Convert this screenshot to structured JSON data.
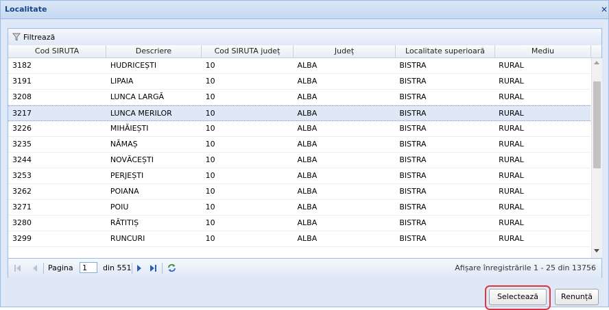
{
  "window": {
    "title": "Localitate",
    "close_label": "✕"
  },
  "toolbar": {
    "filter_label": "Filtrează"
  },
  "columns": [
    "Cod SIRUTA",
    "Descriere",
    "Cod SIRUTA județ",
    "Județ",
    "Localitate superioară",
    "Mediu"
  ],
  "rows": [
    [
      "3182",
      "HUDRICEȘTI",
      "10",
      "ALBA",
      "BISTRA",
      "RURAL"
    ],
    [
      "3191",
      "LIPAIA",
      "10",
      "ALBA",
      "BISTRA",
      "RURAL"
    ],
    [
      "3208",
      "LUNCA LARGĂ",
      "10",
      "ALBA",
      "BISTRA",
      "RURAL"
    ],
    [
      "3217",
      "LUNCA MERILOR",
      "10",
      "ALBA",
      "BISTRA",
      "RURAL"
    ],
    [
      "3226",
      "MIHĂIEȘTI",
      "10",
      "ALBA",
      "BISTRA",
      "RURAL"
    ],
    [
      "3235",
      "NĂMAȘ",
      "10",
      "ALBA",
      "BISTRA",
      "RURAL"
    ],
    [
      "3244",
      "NOVĂCEȘTI",
      "10",
      "ALBA",
      "BISTRA",
      "RURAL"
    ],
    [
      "3253",
      "PERJEȘTI",
      "10",
      "ALBA",
      "BISTRA",
      "RURAL"
    ],
    [
      "3262",
      "POIANA",
      "10",
      "ALBA",
      "BISTRA",
      "RURAL"
    ],
    [
      "3271",
      "POIU",
      "10",
      "ALBA",
      "BISTRA",
      "RURAL"
    ],
    [
      "3280",
      "RĂTITIȘ",
      "10",
      "ALBA",
      "BISTRA",
      "RURAL"
    ],
    [
      "3299",
      "RUNCURI",
      "10",
      "ALBA",
      "BISTRA",
      "RURAL"
    ]
  ],
  "selected_row": 3,
  "paging": {
    "page_label": "Pagina",
    "page_value": "1",
    "of_label": "din 551",
    "display_info": "Afișare înregistrările 1 - 25 din 13756"
  },
  "buttons": {
    "select_label": "Selectează",
    "cancel_label": "Renunță"
  },
  "colors": {
    "header_text": "#15428b",
    "border": "#99bbe8",
    "highlight": "#e0353a"
  }
}
